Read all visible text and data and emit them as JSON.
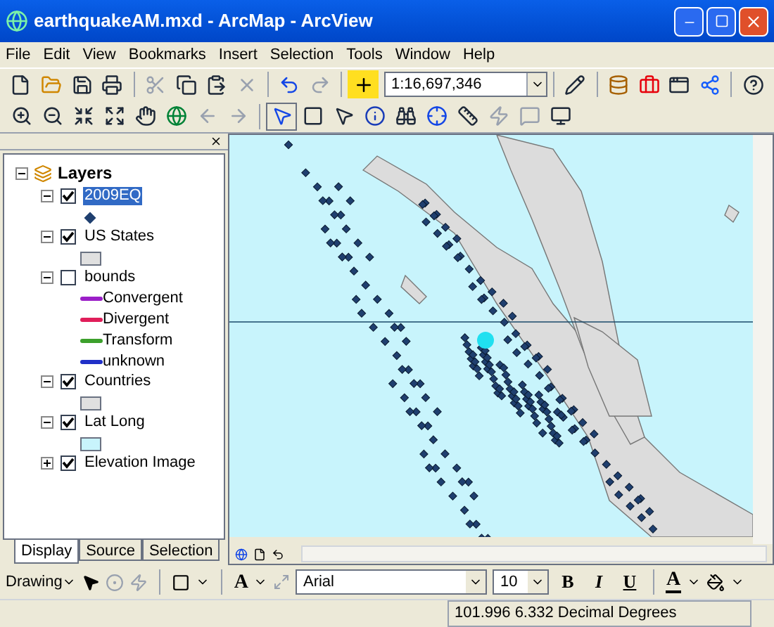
{
  "window": {
    "title": "earthquakeAM.mxd - ArcMap - ArcView"
  },
  "menu": [
    "File",
    "Edit",
    "View",
    "Bookmarks",
    "Insert",
    "Selection",
    "Tools",
    "Window",
    "Help"
  ],
  "scale": {
    "value": "1:16,697,346"
  },
  "toc": {
    "root": "Layers",
    "layers": [
      {
        "name": "2009EQ",
        "checked": true,
        "expanded": true,
        "selected": true,
        "legend": [
          {
            "kind": "point",
            "color": "#1f3f6f"
          }
        ]
      },
      {
        "name": "US States",
        "checked": true,
        "expanded": true,
        "selected": false,
        "legend": [
          {
            "kind": "fill",
            "color": "#e0e0e0"
          }
        ]
      },
      {
        "name": "bounds",
        "checked": false,
        "expanded": true,
        "selected": false,
        "legend": [
          {
            "kind": "line",
            "label": "Convergent",
            "color": "#9b1fc8"
          },
          {
            "kind": "line",
            "label": "Divergent",
            "color": "#e01e5a"
          },
          {
            "kind": "line",
            "label": "Transform",
            "color": "#3ca02c"
          },
          {
            "kind": "line",
            "label": "unknown",
            "color": "#2030c8"
          }
        ]
      },
      {
        "name": "Countries",
        "checked": true,
        "expanded": true,
        "selected": false,
        "legend": [
          {
            "kind": "fill",
            "color": "#e0e0e0"
          }
        ]
      },
      {
        "name": "Lat Long",
        "checked": true,
        "expanded": true,
        "selected": false,
        "legend": [
          {
            "kind": "fill",
            "color": "#c8f4fc"
          }
        ]
      },
      {
        "name": "Elevation Image",
        "checked": true,
        "expanded": false,
        "selected": false
      }
    ]
  },
  "toc_tabs": [
    {
      "label": "Display",
      "selected": true
    },
    {
      "label": "Source",
      "selected": false
    },
    {
      "label": "Selection",
      "selected": false
    }
  ],
  "drawing_toolbar": {
    "menu": "Drawing",
    "font": "Arial",
    "size": "10",
    "styles": [
      "B",
      "I",
      "U"
    ],
    "text_tool": "A",
    "font_color": "A"
  },
  "status_bar": {
    "coordinates": "101.996  6.332 Decimal Degrees"
  }
}
